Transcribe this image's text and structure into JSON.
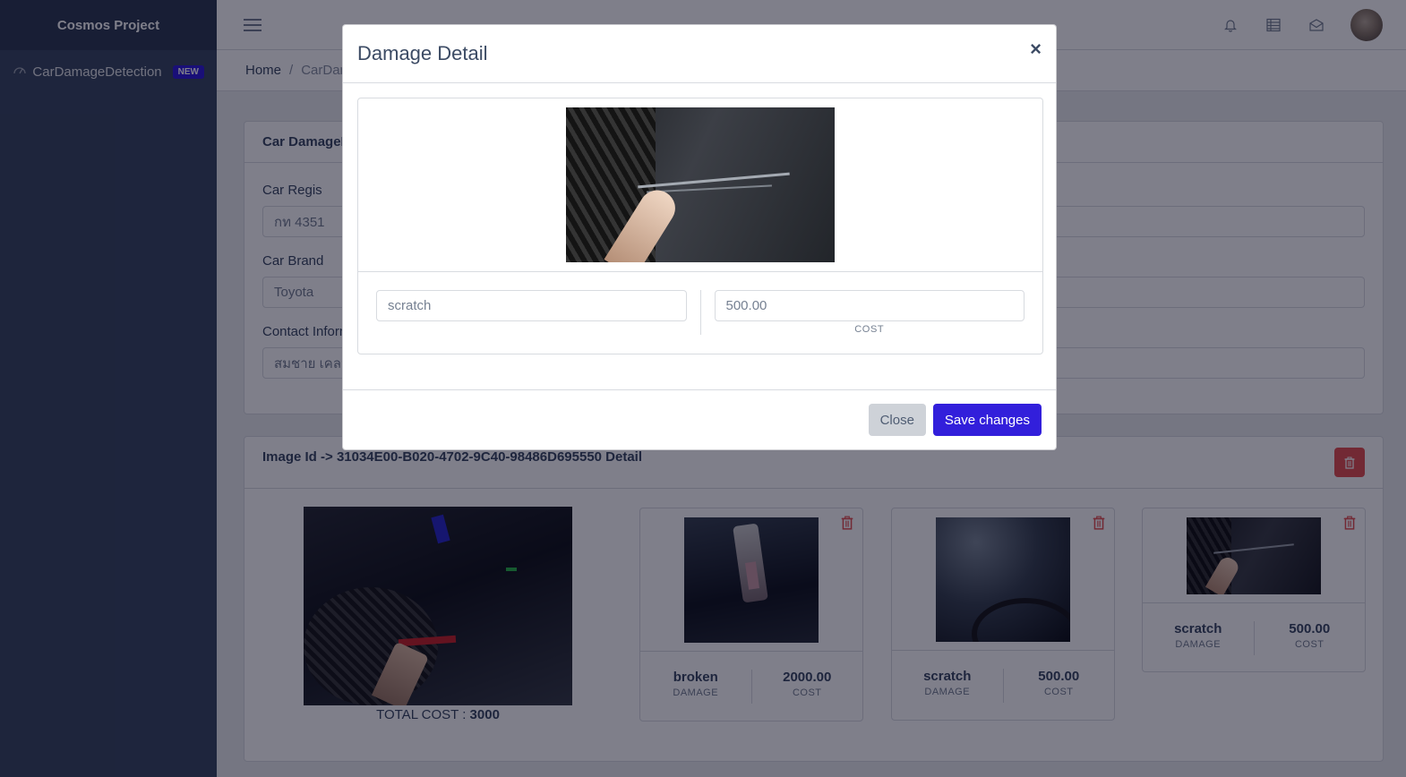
{
  "sidebar": {
    "brand": "Cosmos Project",
    "items": [
      {
        "label": "CarDamageDetection",
        "badge": "NEW",
        "icon": "speedometer-icon"
      }
    ]
  },
  "header": {
    "icons": [
      "menu-icon",
      "bell-icon",
      "list-icon",
      "envelope-icon"
    ]
  },
  "breadcrumb": {
    "home": "Home",
    "separator": "/",
    "current": "CarDamageDetection"
  },
  "form_card": {
    "title": "Car DamageDetection",
    "fields": [
      {
        "label": "Car Regis",
        "value": "กท 4351"
      },
      {
        "label": "Car Brand",
        "value": "Toyota"
      },
      {
        "label": "Contact Information",
        "value": "สมชาย เคลมดี"
      }
    ]
  },
  "detail_card": {
    "title": "Image Id -> 31034E00-B020-4702-9C40-98486D695550 Detail",
    "total_label": "TOTAL COST : ",
    "total_value": "3000",
    "damages": [
      {
        "damage": "broken",
        "cost": "2000.00",
        "damage_label": "DAMAGE",
        "cost_label": "COST"
      },
      {
        "damage": "scratch",
        "cost": "500.00",
        "damage_label": "DAMAGE",
        "cost_label": "COST"
      },
      {
        "damage": "scratch",
        "cost": "500.00",
        "damage_label": "DAMAGE",
        "cost_label": "COST"
      }
    ]
  },
  "modal": {
    "title": "Damage Detail",
    "close_symbol": "×",
    "damage_value": "scratch",
    "cost_value": "500.00",
    "cost_label": "COST",
    "close_button": "Close",
    "save_button": "Save changes"
  },
  "colors": {
    "sidebar": "#3c4b64",
    "primary": "#321fdb",
    "danger": "#e55353",
    "secondary": "#ced2d8"
  }
}
